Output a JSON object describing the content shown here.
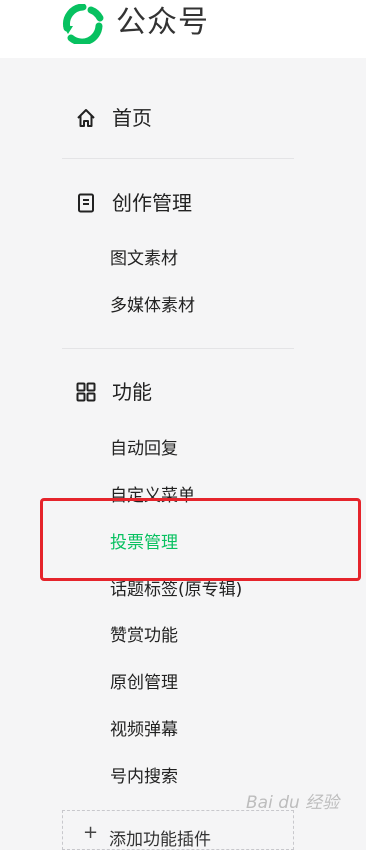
{
  "header": {
    "brand": "公众号",
    "logo_icon": "wechat-mp-logo-icon",
    "brand_color": "#07c160"
  },
  "nav": {
    "home": {
      "label": "首页",
      "icon": "home-icon"
    },
    "create": {
      "label": "创作管理",
      "icon": "document-icon",
      "items": [
        "图文素材",
        "多媒体素材"
      ]
    },
    "features": {
      "label": "功能",
      "icon": "grid-icon",
      "items": [
        "自动回复",
        "自定义菜单",
        "投票管理",
        "话题标签(原专辑)",
        "赞赏功能",
        "原创管理",
        "视频弹幕",
        "号内搜索"
      ],
      "active_index": 2
    },
    "add_plugin": {
      "label": "添加功能插件",
      "icon": "plus-icon"
    }
  },
  "colors": {
    "active": "#07c160",
    "highlight_box": "#e5242b"
  },
  "watermark": "Bai du 经验"
}
